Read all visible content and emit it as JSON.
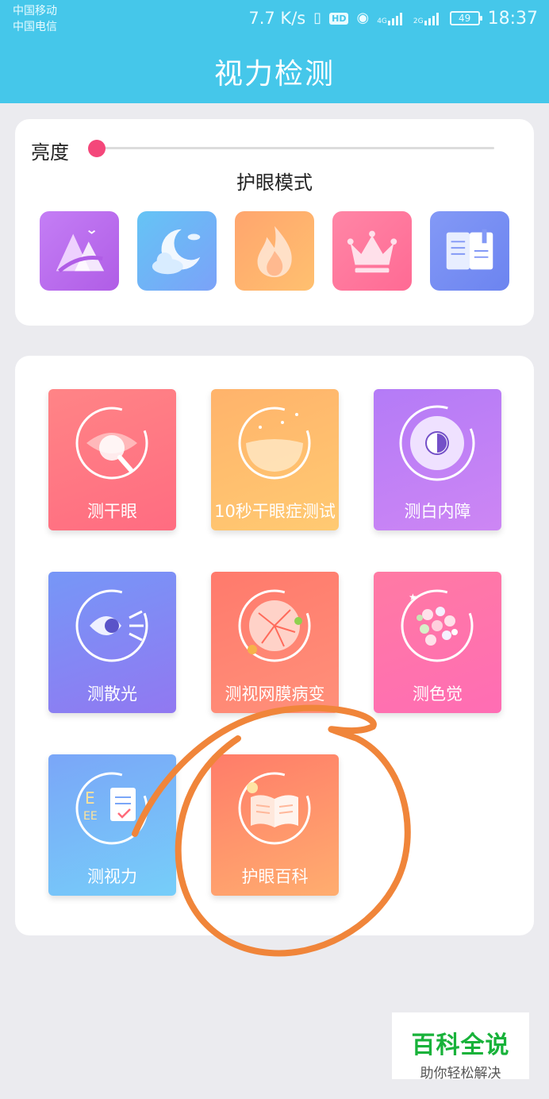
{
  "status_bar": {
    "carrier_1": "中国移动",
    "carrier_2": "中国电信",
    "speed": "7.7 K/s",
    "hd": "HD",
    "net_4g": "4G",
    "net_2g": "2G",
    "battery": "49",
    "time": "18:37"
  },
  "header": {
    "title": "视力检测"
  },
  "brightness": {
    "label": "亮度",
    "level_percent": 0
  },
  "eye_mode": {
    "title": "护眼模式",
    "modes": [
      {
        "icon": "mountain-icon",
        "color_from": "#c070f0",
        "color_to": "#b060e8"
      },
      {
        "icon": "moon-cloud-icon",
        "color_from": "#6fb8f5",
        "color_to": "#78a4f8"
      },
      {
        "icon": "flame-icon",
        "color_from": "#ff9d72",
        "color_to": "#ffb56e"
      },
      {
        "icon": "crown-icon",
        "color_from": "#ff7ea0",
        "color_to": "#ff6e96"
      },
      {
        "icon": "book-icon",
        "color_from": "#7f95f5",
        "color_to": "#6e86f2"
      }
    ]
  },
  "tests": [
    {
      "label": "测干眼",
      "icon": "eye-magnifier-icon",
      "color_from": "#ff7f85",
      "color_to": "#ff6f80"
    },
    {
      "label": "10秒干眼症测试",
      "icon": "tear-bowl-icon",
      "color_from": "#ffb86c",
      "color_to": "#ffc870"
    },
    {
      "label": "测白内障",
      "icon": "iris-icon",
      "color_from": "#b67cf7",
      "color_to": "#c683f5"
    },
    {
      "label": "测散光",
      "icon": "eye-rays-icon",
      "color_from": "#7d8ef7",
      "color_to": "#8e7cf3"
    },
    {
      "label": "测视网膜病变",
      "icon": "retina-icon",
      "color_from": "#ff7e6c",
      "color_to": "#ff8e77"
    },
    {
      "label": "测色觉",
      "icon": "color-dots-icon",
      "color_from": "#ff78a0",
      "color_to": "#ff6fb0"
    },
    {
      "label": "测视力",
      "icon": "eye-chart-icon",
      "color_from": "#7cc8f9",
      "color_to": "#6ea4f7"
    },
    {
      "label": "护眼百科",
      "icon": "open-book-icon",
      "color_from": "#ff7c6a",
      "color_to": "#ffa86e"
    }
  ],
  "watermark": {
    "title": "百科全说",
    "subtitle": "助你轻松解决"
  },
  "colors": {
    "header": "#45c7ea",
    "annotation": "#f0853a",
    "slider_thumb": "#f4477a"
  }
}
